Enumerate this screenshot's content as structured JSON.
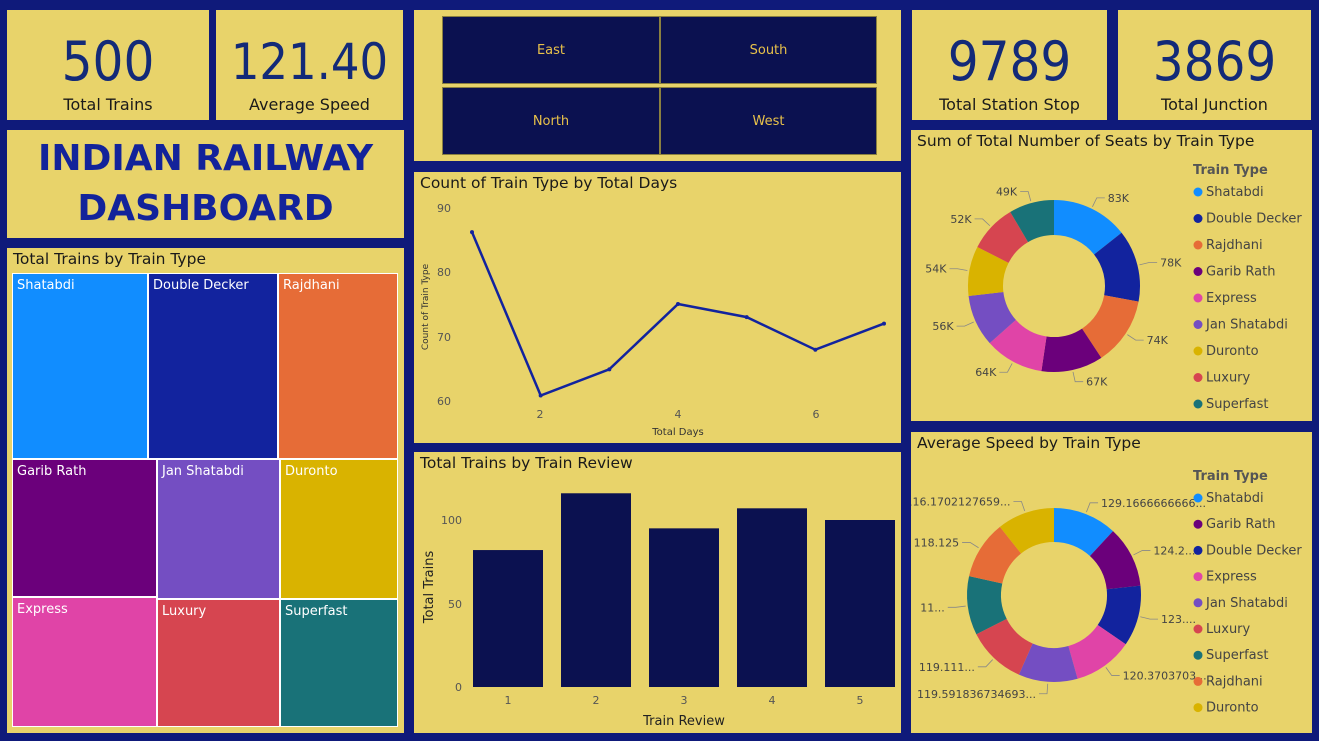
{
  "kpis": {
    "total_trains": {
      "value": "500",
      "label": "Total Trains"
    },
    "average_speed": {
      "value": "121.40",
      "label": "Average Speed"
    },
    "total_station_stop": {
      "value": "9789",
      "label": "Total Station Stop"
    },
    "total_junction": {
      "value": "3869",
      "label": "Total Junction"
    }
  },
  "dashboard_title": {
    "line1": "INDIAN RAILWAY",
    "line2": "DASHBOARD"
  },
  "slicer": {
    "east": "East",
    "south": "South",
    "north": "North",
    "west": "West"
  },
  "colors": {
    "Shatabdi": "#118dff",
    "Double Decker": "#12239e",
    "Rajdhani": "#e66c37",
    "Garib Rath": "#6b007b",
    "Express": "#e044a7",
    "Jan Shatabdi": "#744ec2",
    "Duronto": "#d9b300",
    "Luxury": "#d64550",
    "Superfast": "#197278",
    "line": "#12239e",
    "bar": "#0b1150"
  },
  "treemap": {
    "title": "Total Trains by Train Type",
    "items": [
      "Shatabdi",
      "Double Decker",
      "Rajdhani",
      "Garib Rath",
      "Jan Shatabdi",
      "Duronto",
      "Express",
      "Luxury",
      "Superfast"
    ]
  },
  "line_chart": {
    "title": "Count of Train Type by Total Days",
    "xlabel": "Total Days",
    "ylabel": "Count of Train Type",
    "yticks": [
      "90",
      "80",
      "70",
      "60"
    ],
    "xticks": [
      "2",
      "4",
      "6"
    ]
  },
  "bar_chart": {
    "title": "Total Trains by Train Review",
    "xlabel": "Train Review",
    "ylabel": "Total Trains",
    "yticks": [
      "100",
      "50",
      "0"
    ],
    "categories": [
      "1",
      "2",
      "3",
      "4",
      "5"
    ]
  },
  "donut1": {
    "title": "Sum of Total Number of Seats by Train Type",
    "legend_title": "Train Type",
    "legend": [
      "Shatabdi",
      "Double Decker",
      "Rajdhani",
      "Garib Rath",
      "Express",
      "Jan Shatabdi",
      "Duronto",
      "Luxury",
      "Superfast"
    ],
    "labels": [
      "83K",
      "78K",
      "74K",
      "67K",
      "64K",
      "56K",
      "54K",
      "52K",
      "49K"
    ]
  },
  "donut2": {
    "title": "Average Speed by Train Type",
    "legend_title": "Train Type",
    "legend": [
      "Shatabdi",
      "Garib Rath",
      "Double Decker",
      "Express",
      "Jan Shatabdi",
      "Luxury",
      "Superfast",
      "Rajdhani",
      "Duronto"
    ],
    "labels": [
      "129.1666666666...",
      "124.2...",
      "123....",
      "120.3703703...",
      "119.591836734693...",
      "119.111...",
      "11...",
      "118.125",
      "116.1702127659..."
    ]
  },
  "chart_data": [
    {
      "type": "treemap",
      "title": "Total Trains by Train Type",
      "categories": [
        "Shatabdi",
        "Double Decker",
        "Rajdhani",
        "Garib Rath",
        "Jan Shatabdi",
        "Duronto",
        "Express",
        "Luxury",
        "Superfast"
      ],
      "values": [
        66,
        63,
        58,
        55,
        50,
        48,
        47,
        46,
        45
      ]
    },
    {
      "type": "line",
      "title": "Count of Train Type by Total Days",
      "xlabel": "Total Days",
      "ylabel": "Count of Train Type",
      "x": [
        1,
        2,
        3,
        4,
        5,
        6,
        7
      ],
      "y": [
        86,
        61,
        65,
        75,
        73,
        68,
        72
      ],
      "xlim": [
        1,
        7
      ],
      "ylim": [
        58,
        92
      ],
      "grid": false
    },
    {
      "type": "bar",
      "title": "Total Trains by Train Review",
      "xlabel": "Train Review",
      "ylabel": "Total Trains",
      "categories": [
        "1",
        "2",
        "3",
        "4",
        "5"
      ],
      "values": [
        82,
        116,
        95,
        107,
        100
      ],
      "ylim": [
        0,
        120
      ],
      "grid": false
    },
    {
      "type": "pie",
      "title": "Sum of Total Number of Seats by Train Type",
      "categories": [
        "Shatabdi",
        "Double Decker",
        "Rajdhani",
        "Garib Rath",
        "Express",
        "Jan Shatabdi",
        "Duronto",
        "Luxury",
        "Superfast"
      ],
      "values": [
        83000,
        78000,
        74000,
        67000,
        64000,
        56000,
        54000,
        52000,
        49000
      ],
      "legend": "right"
    },
    {
      "type": "pie",
      "title": "Average Speed by Train Type",
      "categories": [
        "Shatabdi",
        "Garib Rath",
        "Double Decker",
        "Express",
        "Jan Shatabdi",
        "Luxury",
        "Superfast",
        "Rajdhani",
        "Duronto"
      ],
      "values": [
        129.17,
        124.2,
        123.0,
        120.37,
        119.59,
        119.11,
        118.9,
        118.125,
        116.17
      ],
      "legend": "right"
    }
  ]
}
